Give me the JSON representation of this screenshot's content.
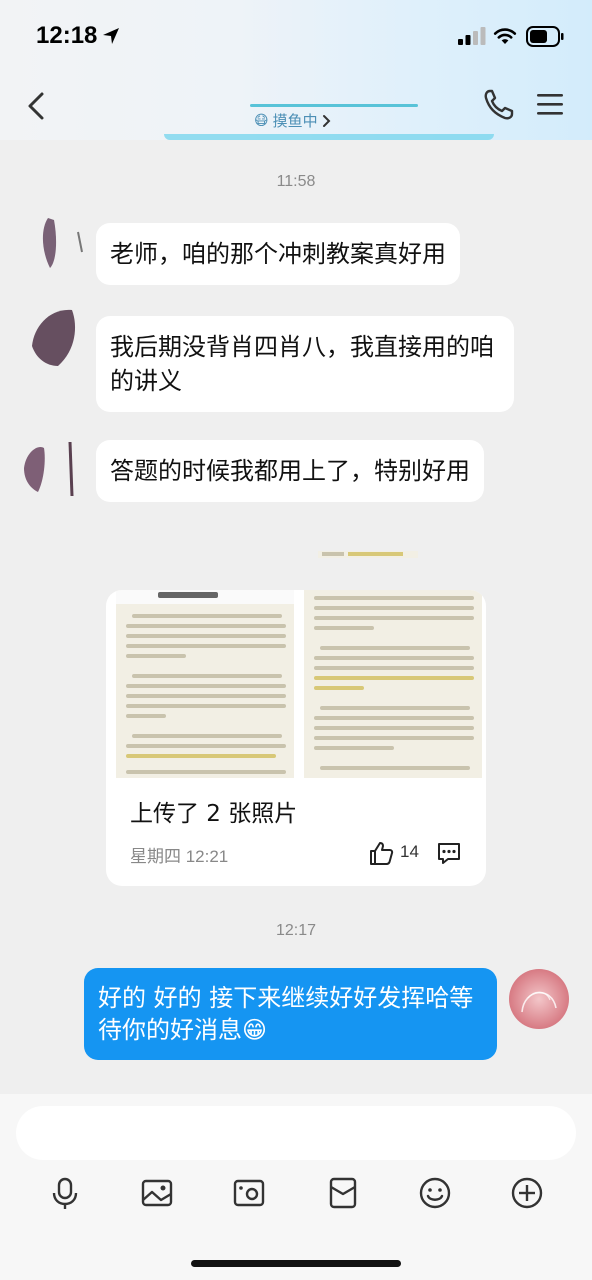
{
  "status_bar": {
    "time": "12:18"
  },
  "header": {
    "status_emoji": "😷",
    "status_text": "摸鱼中",
    "icons": [
      "back-icon",
      "phone-icon",
      "menu-icon"
    ]
  },
  "messages": [
    {
      "type": "timestamp",
      "text": "11:58"
    },
    {
      "type": "incoming",
      "text": "老师，咱的那个冲刺教案真好用"
    },
    {
      "type": "incoming",
      "text": "我后期没背肖四肖八，我直接用的咱的讲义"
    },
    {
      "type": "incoming",
      "text": "答题的时候我都用上了，特别好用"
    },
    {
      "type": "album",
      "title": "上传了 2 张照片",
      "date": "星期四 12:21",
      "likes": "14"
    },
    {
      "type": "timestamp",
      "text": "12:17"
    },
    {
      "type": "outgoing",
      "text": "好的 好的 接下来继续好好发挥哈等待你的好消息😁"
    }
  ],
  "input": {
    "placeholder": "",
    "tools": [
      "microphone-icon",
      "image-icon",
      "camera-icon",
      "red-packet-icon",
      "emoji-icon",
      "plus-icon"
    ]
  },
  "colors": {
    "accent": "#1595f2",
    "chat_background": "#efefef",
    "header_gradient_end": "#d3ecfb"
  }
}
